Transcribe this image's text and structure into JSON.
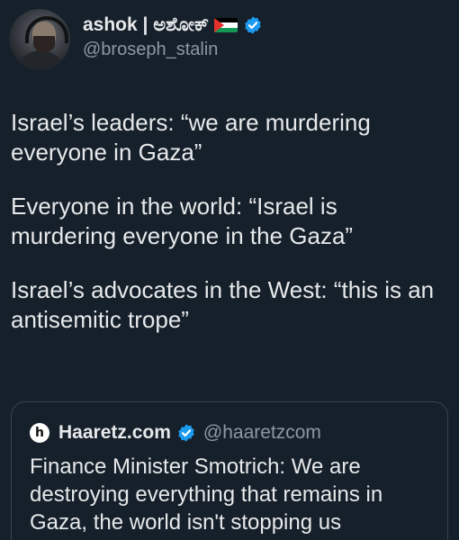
{
  "author": {
    "display_name": "ashok | ಅಶೋಕ್",
    "handle": "@broseph_stalin",
    "flag_icon": "palestine-flag-icon",
    "verified_icon": "verified-badge-icon"
  },
  "tweet": {
    "paragraphs": [
      "Israel’s leaders: “we are murdering everyone in Gaza”",
      "Everyone in the world: “Israel is murdering everyone in the Gaza”",
      "Israel’s advocates in the West: “this is an antisemitic trope”"
    ]
  },
  "quoted": {
    "display_name": "Haaretz.com",
    "handle": "@haaretzcom",
    "logo_letter": "h",
    "text": "Finance Minister Smotrich: We are destroying everything that remains in Gaza, the world isn't stopping us"
  },
  "colors": {
    "background": "#15202b",
    "text": "#e7e9ea",
    "secondary_text": "#8b98a5",
    "verified_blue": "#1d9bf0",
    "border": "#38444d"
  }
}
